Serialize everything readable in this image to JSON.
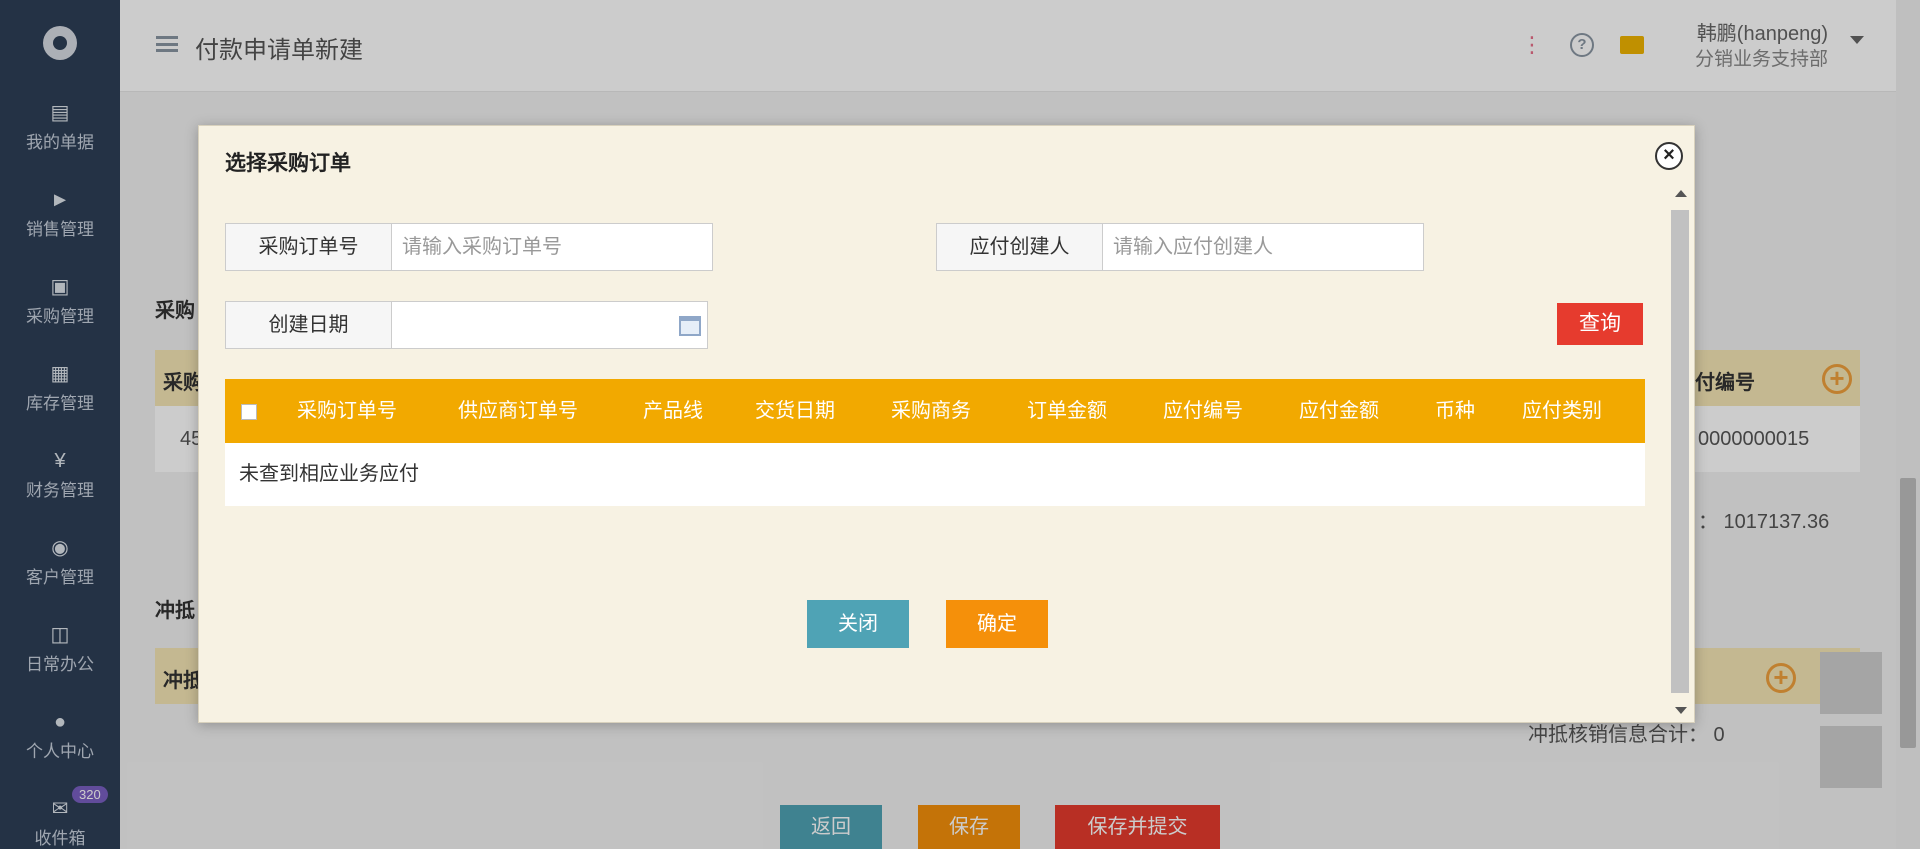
{
  "app": {
    "page_title": "付款申请单新建"
  },
  "sidebar": {
    "items": [
      {
        "label": "我的单据",
        "icon": "documents-icon"
      },
      {
        "label": "销售管理",
        "icon": "tag-icon"
      },
      {
        "label": "采购管理",
        "icon": "truck-icon"
      },
      {
        "label": "库存管理",
        "icon": "grid-icon"
      },
      {
        "label": "财务管理",
        "icon": "yen-icon"
      },
      {
        "label": "客户管理",
        "icon": "target-icon"
      },
      {
        "label": "日常办公",
        "icon": "office-icon"
      },
      {
        "label": "个人中心",
        "icon": "user-icon"
      },
      {
        "label": "收件箱",
        "icon": "mail-icon",
        "badge": "320"
      }
    ]
  },
  "header": {
    "user_name": "韩鹏(hanpeng)",
    "user_dept": "分销业务支持部",
    "colors": {
      "wave": "#e8708a",
      "help": "#8a96a3",
      "mail": "#f0b400"
    }
  },
  "background": {
    "section1_title": "采购",
    "section1_col": "采购",
    "col_pay_no": "付编号",
    "row_value_left": "45",
    "row_value_right": "0000000015",
    "total_text": "：  1017137.36",
    "section2_title": "冲抵",
    "section2_col": "冲抵",
    "offset_total": "冲抵核销信息合计：  0",
    "buttons": {
      "back": "返回",
      "save": "保存",
      "save_submit": "保存并提交"
    }
  },
  "modal": {
    "title": "选择采购订单",
    "filters": {
      "po_no": {
        "label": "采购订单号",
        "placeholder": "请输入采购订单号",
        "value": ""
      },
      "creator": {
        "label": "应付创建人",
        "placeholder": "请输入应付创建人",
        "value": ""
      },
      "create_date": {
        "label": "创建日期",
        "value": ""
      }
    },
    "query_label": "查询",
    "columns": [
      "采购订单号",
      "供应商订单号",
      "产品线",
      "交货日期",
      "采购商务",
      "订单金额",
      "应付编号",
      "应付金额",
      "币种",
      "应付类别"
    ],
    "empty_text": "未查到相应业务应付",
    "close_label": "关闭",
    "confirm_label": "确定",
    "colors": {
      "header": "#f2a900",
      "query": "#e63b2e",
      "close": "#4fa3b5",
      "confirm": "#f5900a"
    }
  }
}
